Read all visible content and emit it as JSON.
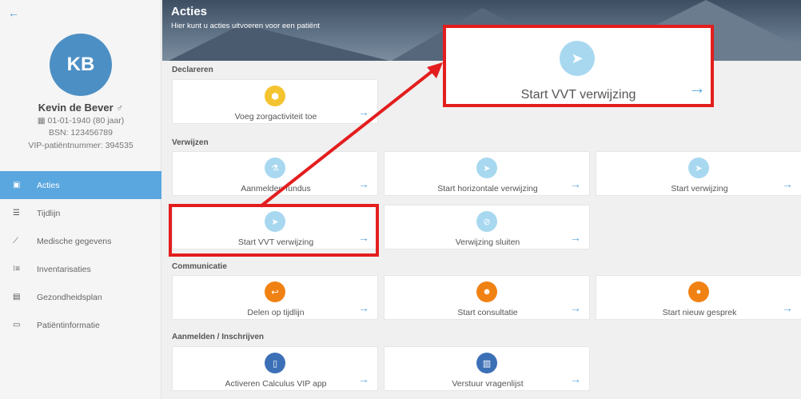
{
  "sidebar": {
    "back_icon": "arrow-left-icon",
    "avatar_initials": "KB",
    "patient_name": "Kevin de Bever",
    "gender_symbol": "♂",
    "birth_date": "01-01-1940 (80 jaar)",
    "bsn": "BSN: 123456789",
    "vip_number": "VIP-patiëntnummer: 394535",
    "nav": [
      {
        "label": "Acties",
        "icon": "calendar-icon"
      },
      {
        "label": "Tijdlijn",
        "icon": "list-icon"
      },
      {
        "label": "Medische gegevens",
        "icon": "chart-line-icon"
      },
      {
        "label": "Inventarisaties",
        "icon": "numbered-list-icon"
      },
      {
        "label": "Gezondheidsplan",
        "icon": "file-icon"
      },
      {
        "label": "Patiëntinformatie",
        "icon": "id-card-icon"
      }
    ]
  },
  "header": {
    "title": "Acties",
    "subtitle": "Hier kunt u acties uitvoeren voor een patiënt"
  },
  "sections": {
    "declareren": "Declareren",
    "verwijzen": "Verwijzen",
    "communicatie": "Communicatie",
    "aanmelden": "Aanmelden / Inschrijven"
  },
  "cards": {
    "zorgactiviteit": "Voeg zorgactiviteit toe",
    "fundus": "Aanmelden fundus",
    "horizontaal": "Start horizontale verwijzing",
    "verwijzing": "Start verwijzing",
    "vvt": "Start VVT verwijzing",
    "sluiten": "Verwijzing sluiten",
    "delen": "Delen op tijdlijn",
    "consultatie": "Start consultatie",
    "gesprek": "Start nieuw gesprek",
    "calculus": "Activeren Calculus VIP app",
    "vragenlijst": "Verstuur vragenlijst"
  },
  "zoom": {
    "label": "Start VVT verwijzing"
  },
  "colors": {
    "accent": "#5aa7e0",
    "highlight": "#e31e1e"
  }
}
